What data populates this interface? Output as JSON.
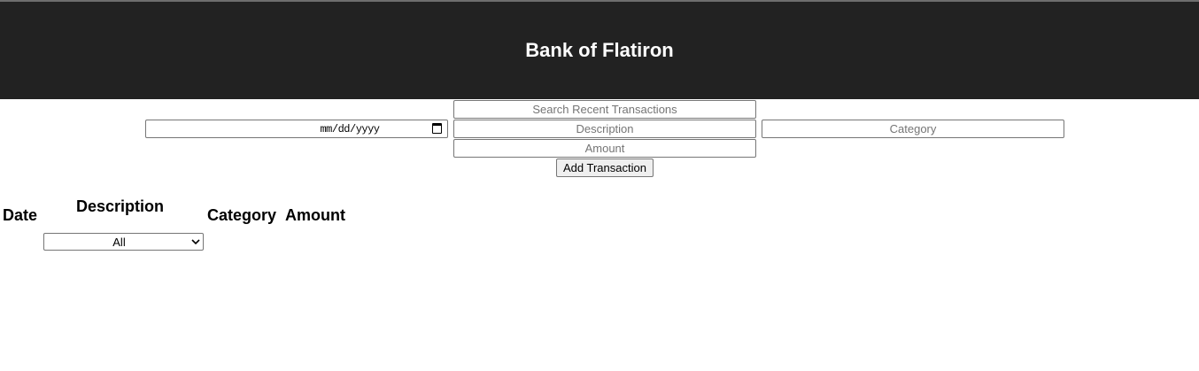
{
  "header": {
    "title": "Bank of Flatiron"
  },
  "search": {
    "placeholder": "Search Recent Transactions"
  },
  "form": {
    "date_placeholder": "mm/dd/yyyy",
    "description_placeholder": "Description",
    "category_placeholder": "Category",
    "amount_placeholder": "Amount",
    "submit_label": "Add Transaction"
  },
  "table": {
    "columns": [
      "Date",
      "Description",
      "Category",
      "Amount"
    ],
    "description_filter": {
      "selected": "All"
    }
  },
  "icons": {
    "date": "calendar-icon",
    "filter": "chevron-down-icon"
  },
  "colors": {
    "header_bg": "#222222",
    "header_text": "#ffffff"
  }
}
